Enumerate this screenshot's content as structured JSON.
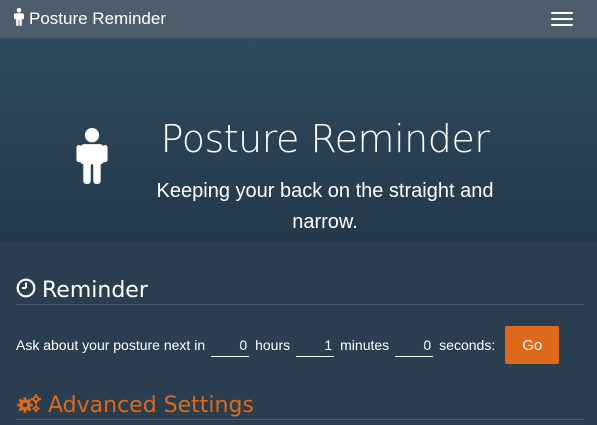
{
  "navbar": {
    "brand_icon": "male-person-icon",
    "brand_label": "Posture Reminder",
    "menu_icon": "hamburger-menu-icon"
  },
  "hero": {
    "icon": "male-person-icon",
    "title": "Posture Reminder",
    "subtitle": "Keeping your back on the straight and narrow."
  },
  "reminder": {
    "icon": "clock-icon",
    "heading": "Reminder",
    "prompt": "Ask about your posture next in",
    "hours_value": "0",
    "hours_label": "hours",
    "minutes_value": "1",
    "minutes_label": "minutes",
    "seconds_value": "0",
    "seconds_label": "seconds:",
    "go_label": "Go"
  },
  "advanced": {
    "icon": "gears-icon",
    "heading": "Advanced Settings"
  },
  "colors": {
    "background": "#2b3e50",
    "navbar": "#4e5d6c",
    "accent": "#df691a"
  }
}
